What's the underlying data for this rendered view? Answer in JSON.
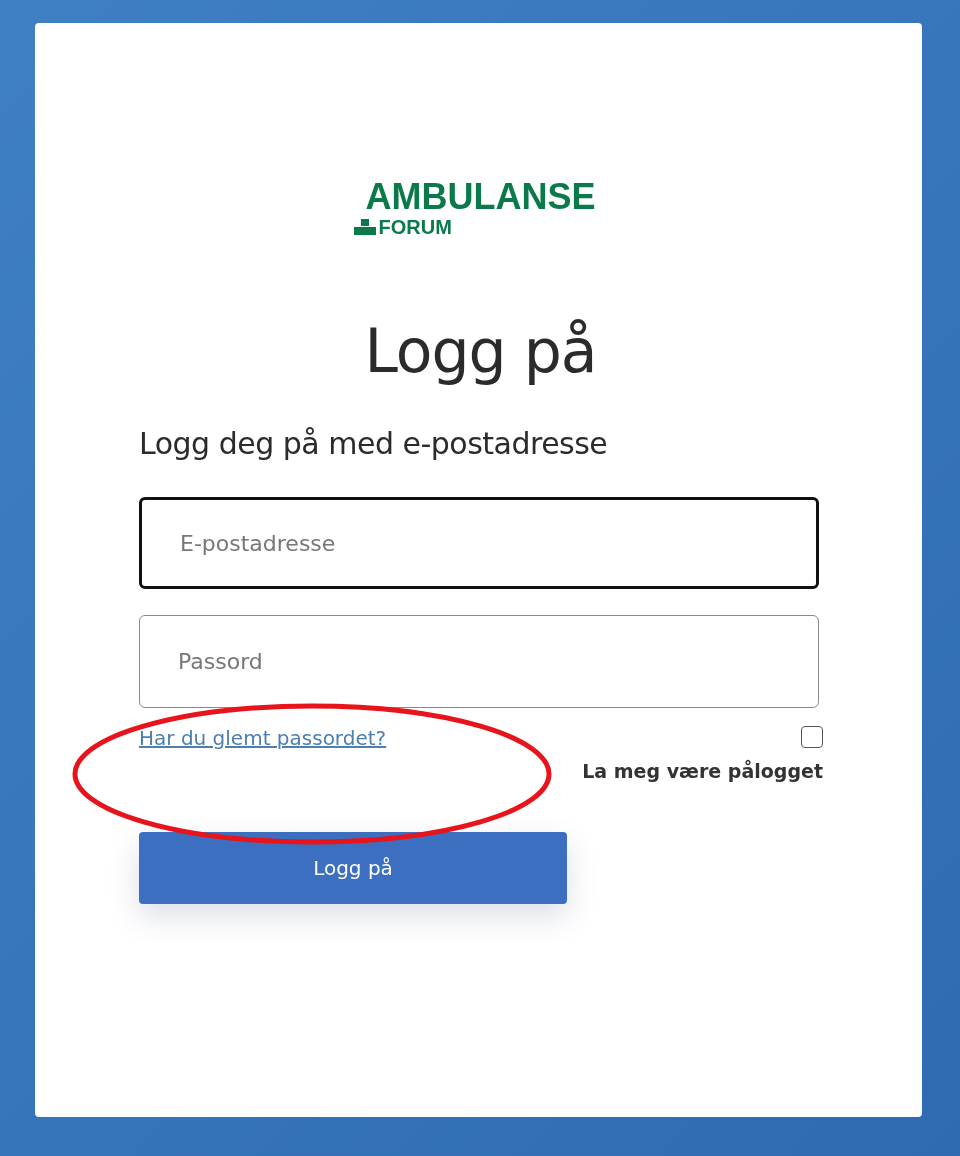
{
  "logo": {
    "line_1": "AMBULANSE",
    "line_2": "FORUM"
  },
  "title": "Logg på",
  "subtitle": "Logg deg på med e-postadresse",
  "fields": [
    {
      "placeholder": "E-postadresse",
      "focused": true
    },
    {
      "placeholder": "Passord",
      "focused": false
    }
  ],
  "forgot_link": "Har du glemt passordet?",
  "remember": {
    "label": "La meg være pålogget",
    "checked": false
  },
  "submit_button": "Logg på"
}
